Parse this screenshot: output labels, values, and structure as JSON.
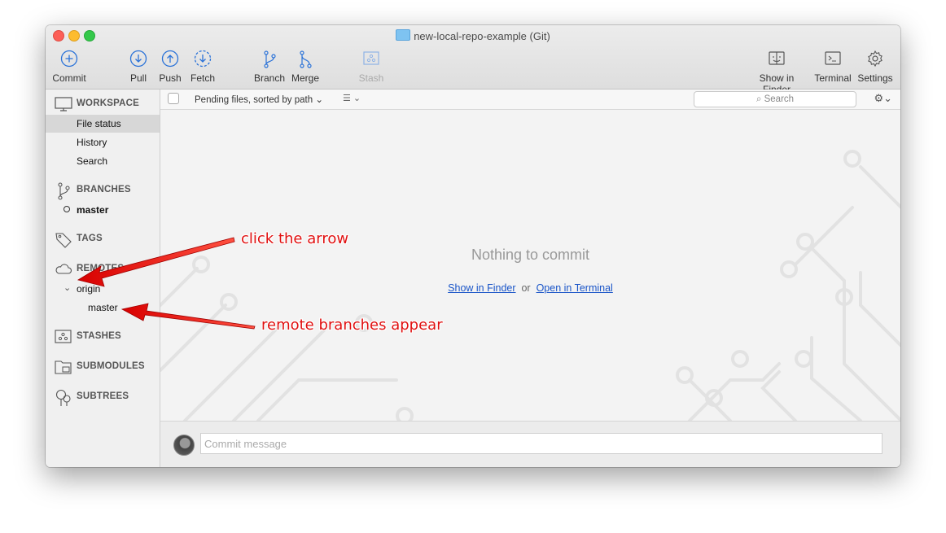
{
  "window": {
    "title": "new-local-repo-example (Git)"
  },
  "toolbar": {
    "commit": "Commit",
    "pull": "Pull",
    "push": "Push",
    "fetch": "Fetch",
    "branch": "Branch",
    "merge": "Merge",
    "stash": "Stash",
    "show_in_finder": "Show in Finder",
    "terminal": "Terminal",
    "settings": "Settings"
  },
  "sidebar": {
    "workspace": "WORKSPACE",
    "file_status": "File status",
    "history": "History",
    "search": "Search",
    "branches": "BRANCHES",
    "current_branch": "master",
    "tags": "TAGS",
    "remotes": "REMOTES",
    "remote_origin": "origin",
    "remote_branch": "master",
    "stashes": "STASHES",
    "submodules": "SUBMODULES",
    "subtrees": "SUBTREES"
  },
  "filter": {
    "pending": "Pending files, sorted by path",
    "search_placeholder": "Search"
  },
  "main": {
    "empty_message": "Nothing to commit",
    "show_in_finder_link": "Show in Finder",
    "or": "or",
    "open_in_terminal_link": "Open in Terminal"
  },
  "commit": {
    "placeholder": "Commit message"
  },
  "annotations": {
    "arrow1": "click the arrow",
    "arrow2": "remote branches appear"
  },
  "colors": {
    "link": "#1a55c8",
    "annotation": "#e01010",
    "icon_blue": "#2a72d8"
  }
}
